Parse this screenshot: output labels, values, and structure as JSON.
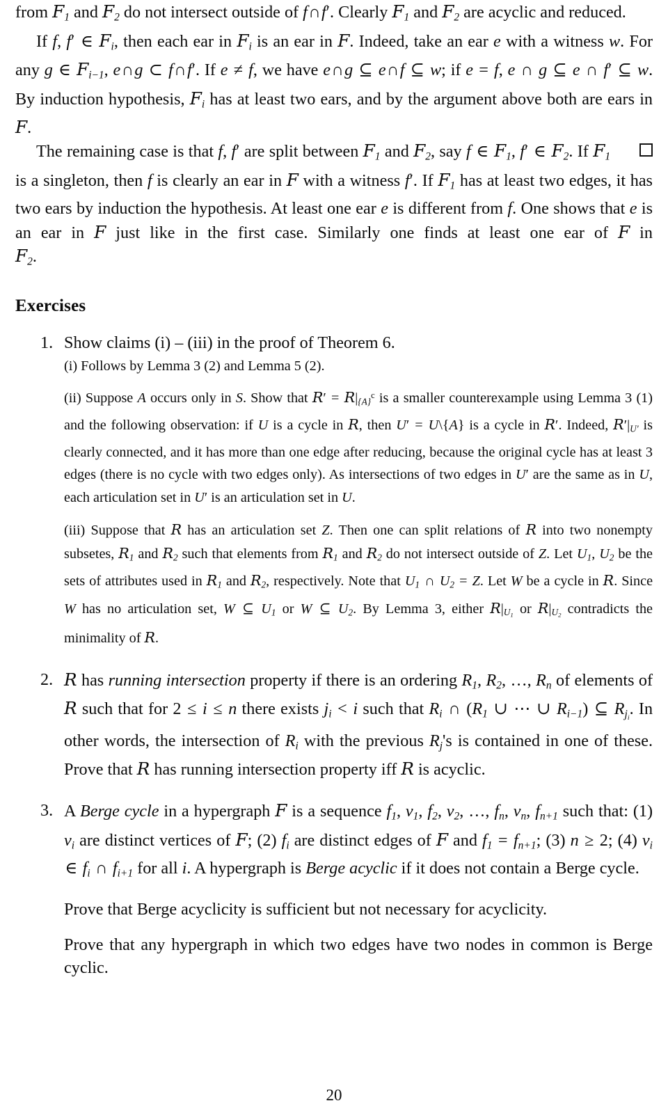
{
  "document": {
    "page_number": "20",
    "body_paragraphs": [
      {
        "id": "p1",
        "text": "from F1 and F2 do not intersect outside of f ∩ f′. Clearly F1 and F2 are acyclic and reduced."
      },
      {
        "id": "p2",
        "text": "If f, f′ ∈ Fi, then each ear in Fi is an ear in F. Indeed, take an ear e with a witness w. For any g ∈ Fi−1, e ∩ g ⊂ f ∩ f′. If e ≠ f, we have e ∩ g ⊆ e ∩ f ⊆ w; if e = f, e ∩ g ⊆ e ∩ f′ ⊆ w. By induction hypothesis, Fi has at least two ears, and by the argument above both are ears in F."
      },
      {
        "id": "p3",
        "text": "The remaining case is that f, f′ are split between F1 and F2, say f ∈ F1, f′ ∈ F2. If F1 is a singleton, then f is clearly an ear in F with a witness f′. If F1 has at least two edges, it has two ears by induction the hypothesis. At least one ear e is different from f. One shows that e is an ear in F just like in the first case. Similarly one finds at least one ear of F in F2."
      }
    ],
    "qed_symbol": "□",
    "exercises_heading": "Exercises",
    "exercises": [
      {
        "number": "1.",
        "lead": "Show claims (i) – (iii) in the proof of Theorem 6.",
        "sub_items": [
          {
            "label": "(i)",
            "text": "(i) Follows by Lemma 3 (2) and Lemma 5 (2)."
          },
          {
            "label": "(ii)",
            "text": "(ii) Suppose A occurs only in S. Show that R′ = R|{A}ᶜ is a smaller counterexample using Lemma 3 (1) and the following observation: if U is a cycle in R, then U′ = U\\{A} is a cycle in R′. Indeed, R′|U′ is clearly connected, and it has more than one edge after reducing, because the original cycle has at least 3 edges (there is no cycle with two edges only). As intersections of two edges in U′ are the same as in U, each articulation set in U′ is an articulation set in U."
          },
          {
            "label": "(iii)",
            "text": "(iii) Suppose that R has an articulation set Z. Then one can split relations of R into two nonempty subsetes, R1 and R2 such that elements from R1 and R2 do not intersect outside of Z. Let U1, U2 be the sets of attributes used in R1 and R2, respectively. Note that U1 ∩ U2 = Z. Let W be a cycle in R. Since W has no articulation set, W ⊆ U1 or W ⊆ U2. By Lemma 3, either R|U1 or R|U2 contradicts the minimality of R."
          }
        ]
      },
      {
        "number": "2.",
        "lead": "R has running intersection property if there is an ordering R1, R2, …, Rn of elements of R such that for 2 ≤ i ≤ n there exists ji < i such that Ri ∩ (R1 ∪ ⋯ ∪ Ri−1) ⊆ Rji. In other words, the intersection of Ri with the previous Rj's is contained in one of these. Prove that R has running intersection property iff R is acyclic.",
        "sub_items": []
      },
      {
        "number": "3.",
        "lead": "A Berge cycle in a hypergraph F is a sequence f1, v1, f2, v2, …, fn, vn, fn+1 such that: (1) vi are distinct vertices of F; (2) fi are distinct edges of F and f1 = fn+1; (3) n ≥ 2; (4) vi ∈ fi ∩ fi+1 for all i. A hypergraph is Berge acyclic if it does not contain a Berge cycle.",
        "sub_items": [
          {
            "label": "prove-1",
            "text": "Prove that Berge acyclicity is sufficient but not necessary for acyclicity."
          },
          {
            "label": "prove-2",
            "text": "Prove that any hypergraph in which two edges have two nodes in common is Berge cyclic."
          }
        ]
      }
    ]
  }
}
